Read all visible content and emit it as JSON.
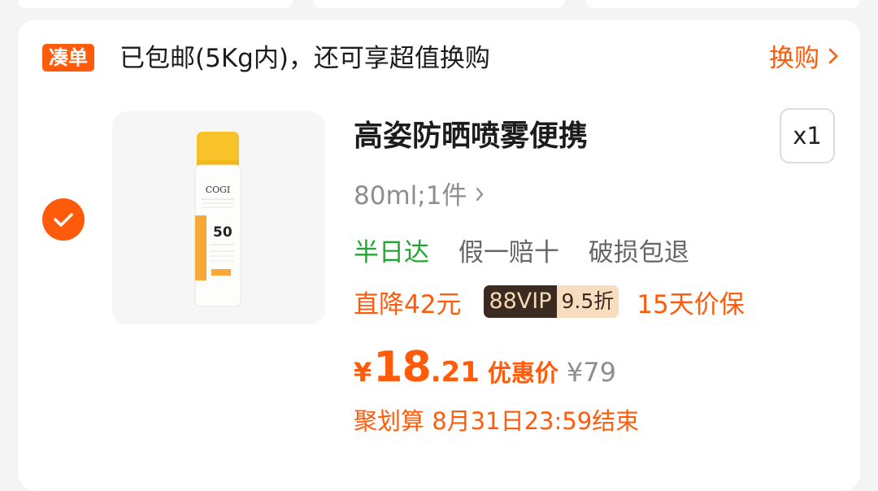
{
  "banner": {
    "tag": "凑单",
    "text": "已包邮(5Kg内)，还可享超值换购",
    "link": "换购"
  },
  "product": {
    "title": "高姿防晒喷雾便携",
    "quantity": "x1",
    "sku": "80ml;1件",
    "selected": true,
    "image": {
      "brand": "COGI",
      "spf": "50"
    },
    "services": [
      "半日达",
      "假一赔十",
      "破损包退"
    ],
    "promos": {
      "discount": "直降42元",
      "vip_label": "88VIP",
      "vip_discount": "9.5折",
      "price_protect": "15天价保"
    },
    "price": {
      "currency": "¥",
      "integer": "18",
      "decimal": ".21",
      "label": "优惠价",
      "original": "¥79"
    },
    "campaign": "聚划算 8月31日23:59结束"
  },
  "colors": {
    "accent": "#ff5b0a",
    "green": "#22a832",
    "gray": "#8e8e8e"
  }
}
